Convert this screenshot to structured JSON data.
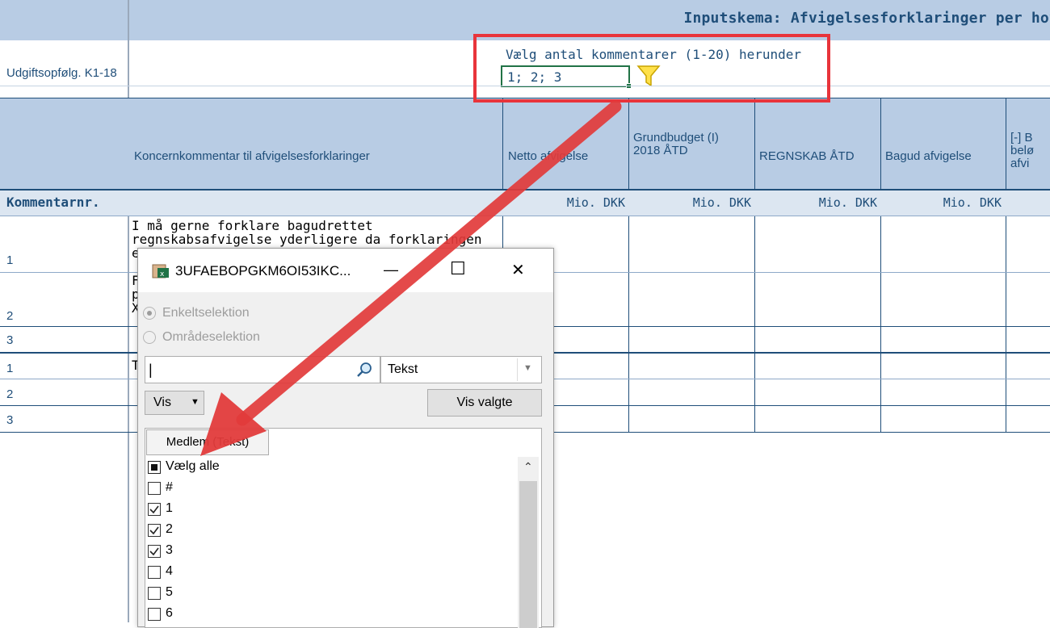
{
  "sheet": {
    "title": "Inputskema: Afvigelsesforklaringer per hov",
    "subtitle": "Udgiftsopfølg. K1-18",
    "columns": [
      "Koncernkommentar til afvigelsesforklaringer",
      "Netto afvigelse",
      "Grundbudget (I) 2018 ÅTD",
      "REGNSKAB ÅTD",
      "Bagud afvigelse",
      "[-] B belø afvi"
    ],
    "unit_label": "Mio. DKK",
    "row_header": "Kommentarnr.",
    "row_numbers": [
      "1",
      "2",
      "3",
      "1",
      "2",
      "3"
    ],
    "comment_text": "I må gerne forklare bagudrettet regnskabsafvigelse yderligere da forklaringen er u",
    "partial_cells": [
      "F",
      "p",
      "X",
      "T"
    ]
  },
  "comment_selector": {
    "label": "Vælg antal kommentarer (1-20) herunder",
    "value": "1; 2; 3",
    "filter_icon": "funnel-icon"
  },
  "dialog": {
    "title": "3UFAEBOPGKM6OI53IKC...",
    "app_icon": "excel-app-icon",
    "minimize": "—",
    "maximize": "☐",
    "close": "✕",
    "radio_single": "Enkeltselektion",
    "radio_range": "Områdeselektion",
    "search_value": "|",
    "search_icon": "magnifier-icon",
    "type_select": "Tekst",
    "vis_button": "Vis",
    "vis_valgte_button": "Vis valgte",
    "column_tab": "Medlem (Tekst)",
    "select_all": "Vælg alle",
    "items": [
      {
        "label": "#",
        "checked": false
      },
      {
        "label": "1",
        "checked": true
      },
      {
        "label": "2",
        "checked": true
      },
      {
        "label": "3",
        "checked": true
      },
      {
        "label": "4",
        "checked": false
      },
      {
        "label": "5",
        "checked": false
      },
      {
        "label": "6",
        "checked": false
      }
    ]
  },
  "colors": {
    "header_blue": "#b8cce4",
    "text_blue": "#1f4e79",
    "highlight_red": "#e8343b",
    "excel_green": "#217346"
  }
}
